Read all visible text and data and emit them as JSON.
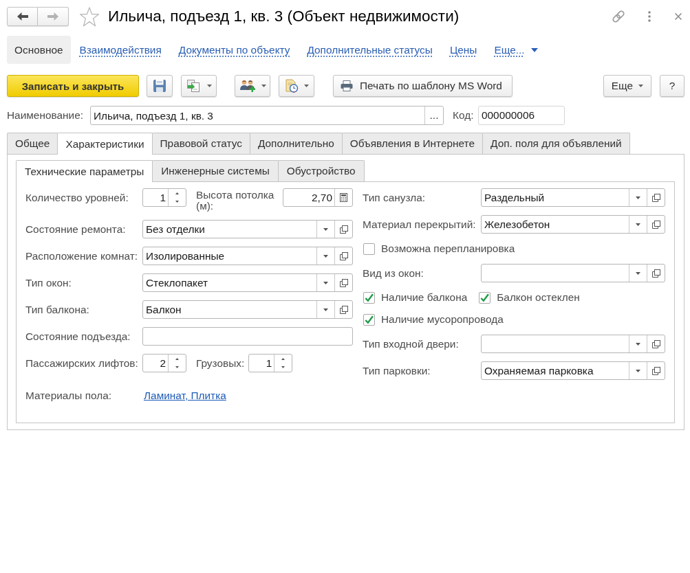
{
  "window": {
    "title": "Ильича, подъезд 1, кв. 3 (Объект недвижимости)",
    "favorite": false
  },
  "nav_buttons": [
    {
      "kind": "back",
      "disabled": false
    },
    {
      "kind": "forward",
      "disabled": true
    }
  ],
  "sections": [
    {
      "label": "Основное",
      "selected": true,
      "kind": "link"
    },
    {
      "label": "Взаимодействия",
      "selected": false,
      "kind": "link"
    },
    {
      "label": "Документы по объекту",
      "selected": false,
      "kind": "link"
    },
    {
      "label": "Дополнительные статусы",
      "selected": false,
      "kind": "link"
    },
    {
      "label": "Цены",
      "selected": false,
      "kind": "link"
    },
    {
      "label": "Еще...",
      "selected": false,
      "kind": "menu"
    }
  ],
  "toolbar": {
    "save_and_close": "Записать и закрыть",
    "print": "Печать по шаблону MS Word",
    "more": "Еще",
    "help": "?"
  },
  "name_field": {
    "label": "Наименование:",
    "value": "Ильича, подъезд 1, кв. 3",
    "choose_button": "..."
  },
  "code_field": {
    "label": "Код:",
    "value": "000000006"
  },
  "tabs": [
    {
      "label": "Общее",
      "selected": false
    },
    {
      "label": "Характеристики",
      "selected": true
    },
    {
      "label": "Правовой статус",
      "selected": false
    },
    {
      "label": "Дополнительно",
      "selected": false
    },
    {
      "label": "Объявления в Интернете",
      "selected": false
    },
    {
      "label": "Доп. поля для объявлений",
      "selected": false
    }
  ],
  "subtabs": [
    {
      "label": "Технические параметры",
      "selected": true
    },
    {
      "label": "Инженерные системы",
      "selected": false
    },
    {
      "label": "Обустройство",
      "selected": false
    }
  ],
  "left_column": [
    {
      "fields": [
        {
          "kind": "spinner",
          "label": "Количество уровней:",
          "value": "1"
        },
        {
          "kind": "number",
          "label": "Высота потолка (м):",
          "value": "2,70"
        }
      ]
    },
    {
      "fields": [
        {
          "kind": "select",
          "label": "Состояние ремонта:",
          "value": "Без отделки"
        }
      ]
    },
    {
      "fields": [
        {
          "kind": "select",
          "label": "Расположение комнат:",
          "value": "Изолированные"
        }
      ]
    },
    {
      "fields": [
        {
          "kind": "select",
          "label": "Тип окон:",
          "value": "Стеклопакет"
        }
      ]
    },
    {
      "fields": [
        {
          "kind": "select",
          "label": "Тип балкона:",
          "value": "Балкон"
        }
      ]
    },
    {
      "fields": [
        {
          "kind": "text",
          "label": "Состояние подъезда:"
        }
      ]
    },
    {
      "fields": [
        {
          "kind": "spinner",
          "label": "Пассажирских лифтов:",
          "value": "2"
        },
        {
          "kind": "spinner",
          "label": "Грузовых:",
          "value": "1"
        }
      ]
    },
    {
      "fields": [
        {
          "kind": "link",
          "label": "Материалы пола:",
          "value": "Ламинат, Плитка"
        }
      ]
    }
  ],
  "right_column": [
    {
      "fields": [
        {
          "kind": "select",
          "label": "Тип санузла:",
          "value": "Раздельный"
        }
      ]
    },
    {
      "fields": [
        {
          "kind": "select",
          "label": "Материал перекрытий:",
          "value": "Железобетон"
        }
      ]
    },
    {
      "fields": [
        {
          "kind": "checkbox",
          "label": "Возможна перепланировка",
          "checked": false
        }
      ]
    },
    {
      "fields": [
        {
          "kind": "select",
          "label": "Вид из окон:"
        }
      ]
    },
    {
      "fields": [
        {
          "kind": "checkbox",
          "label": "Наличие балкона",
          "checked": true
        },
        {
          "kind": "checkbox",
          "label": "Балкон остеклен",
          "checked": true
        }
      ]
    },
    {
      "fields": [
        {
          "kind": "checkbox",
          "label": "Наличие мусоропровода",
          "checked": true
        }
      ]
    },
    {
      "fields": [
        {
          "kind": "select",
          "label": "Тип входной двери:"
        }
      ]
    },
    {
      "fields": [
        {
          "kind": "select",
          "label": "Тип парковки:",
          "value": "Охраняемая парковка"
        }
      ]
    }
  ]
}
